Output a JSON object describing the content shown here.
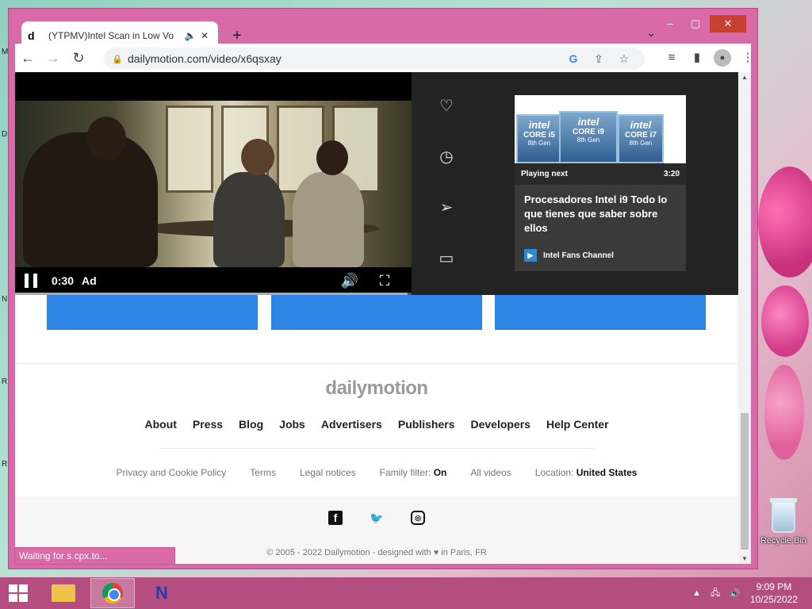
{
  "desktop": {
    "edge_letters": [
      "M",
      "D",
      "N",
      "R",
      "R"
    ],
    "recycle_bin_label": "Recycle Bin"
  },
  "browser": {
    "tab": {
      "favicon_letter": "d",
      "title": "(YTPMV)Intel Scan in Low Vo",
      "audio_icon": "speaker-icon",
      "close_icon": "close-icon"
    },
    "new_tab_icon": "plus-icon",
    "tab_search_icon": "chevron-down-icon",
    "window_controls": [
      "minimize-icon",
      "maximize-icon",
      "close-icon"
    ],
    "toolbar": {
      "back_icon": "back-arrow-icon",
      "forward_icon": "forward-arrow-icon",
      "reload_icon": "reload-icon",
      "url": "dailymotion.com/video/x6qsxay",
      "omnibox_icons": [
        "google-icon",
        "share-icon",
        "star-icon"
      ],
      "right_icons": [
        "media-queue-icon",
        "side-panel-icon",
        "profile-icon",
        "menu-icon"
      ]
    },
    "status_text": "Waiting for s.cpx.to..."
  },
  "player": {
    "time": "0:30",
    "ad_label": "Ad",
    "progress": 0.99,
    "side_actions": [
      "heart-icon",
      "clock-icon",
      "share-send-icon",
      "playlist-icon"
    ],
    "next_card": {
      "thumb_chips": [
        {
          "brand": "intel",
          "core": "CORE i5",
          "gen": "8th Gen"
        },
        {
          "brand": "intel",
          "core": "CORE i9",
          "gen": "8th Gen"
        },
        {
          "brand": "intel",
          "core": "CORE i7",
          "gen": "8th Gen"
        }
      ],
      "playing_next": "Playing next",
      "duration": "3:20",
      "title": "Procesadores Intel i9 Todo lo que tienes que saber sobre ellos",
      "channel": "Intel Fans Channel"
    }
  },
  "footer": {
    "logo": "dailymotion",
    "links": [
      "About",
      "Press",
      "Blog",
      "Jobs",
      "Advertisers",
      "Publishers",
      "Developers",
      "Help Center"
    ],
    "legal": {
      "privacy": "Privacy and Cookie Policy",
      "terms": "Terms",
      "legal_notices": "Legal notices",
      "family_filter_label": "Family filter:",
      "family_filter_value": "On",
      "all_videos": "All videos",
      "location_label": "Location:",
      "location_value": "United States"
    },
    "social": [
      "facebook-icon",
      "twitter-icon",
      "instagram-icon"
    ],
    "copyright": "© 2005 - 2022 Dailymotion - designed with ♥ in Paris, FR"
  },
  "taskbar": {
    "apps": [
      "file-explorer-icon",
      "chrome-icon",
      "n-app-icon"
    ],
    "tray_icons": [
      "tray-up-icon",
      "network-icon",
      "volume-icon"
    ],
    "time": "9:09 PM",
    "date": "10/25/2022"
  }
}
